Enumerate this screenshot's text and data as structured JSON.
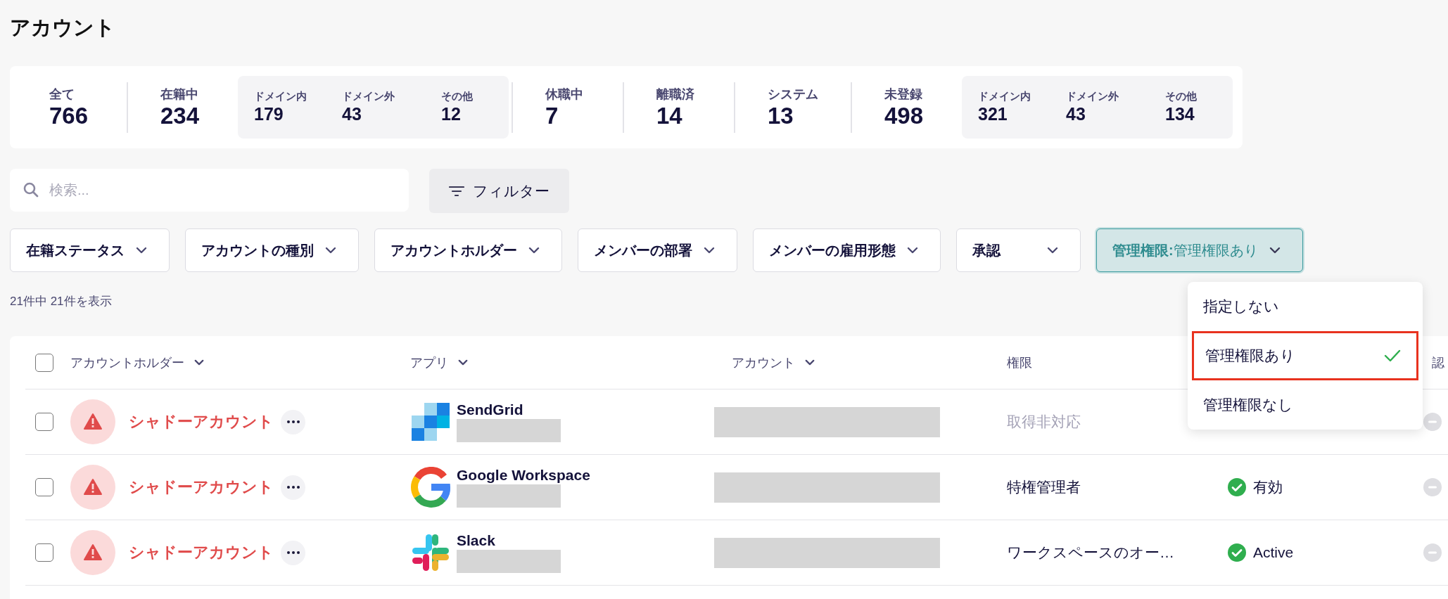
{
  "page": {
    "title": "アカウント"
  },
  "stats": [
    {
      "kind": "stat",
      "label": "全て",
      "value": "766"
    },
    {
      "kind": "stat",
      "label": "在籍中",
      "value": "234"
    },
    {
      "kind": "group",
      "items": [
        {
          "label": "ドメイン内",
          "value": "179"
        },
        {
          "label": "ドメイン外",
          "value": "43"
        },
        {
          "label": "その他",
          "value": "12"
        }
      ]
    },
    {
      "kind": "stat",
      "label": "休職中",
      "value": "7"
    },
    {
      "kind": "stat",
      "label": "離職済",
      "value": "14"
    },
    {
      "kind": "stat",
      "label": "システム",
      "value": "13"
    },
    {
      "kind": "stat",
      "label": "未登録",
      "value": "498"
    },
    {
      "kind": "group",
      "items": [
        {
          "label": "ドメイン内",
          "value": "321"
        },
        {
          "label": "ドメイン外",
          "value": "43"
        },
        {
          "label": "その他",
          "value": "134"
        }
      ]
    }
  ],
  "search": {
    "placeholder": "検索..."
  },
  "filter_button": {
    "label": "フィルター"
  },
  "filters": [
    {
      "label": "在籍ステータス",
      "active": false
    },
    {
      "label": "アカウントの種別",
      "active": false
    },
    {
      "label": "アカウントホルダー",
      "active": false
    },
    {
      "label": "メンバーの部署",
      "active": false
    },
    {
      "label": "メンバーの雇用形態",
      "active": false
    },
    {
      "label": "承認",
      "active": false
    },
    {
      "label": "管理権限:",
      "value": "管理権限あり",
      "active": true
    }
  ],
  "dropdown": {
    "options": [
      {
        "label": "指定しない",
        "selected": false
      },
      {
        "label": "管理権限あり",
        "selected": true
      },
      {
        "label": "管理権限なし",
        "selected": false
      }
    ]
  },
  "result_count": "21件中 21件を表示",
  "table": {
    "columns": {
      "holder": {
        "label": "アカウントホルダー",
        "sortable": true
      },
      "app": {
        "label": "アプリ",
        "sortable": true
      },
      "account": {
        "label": "アカウント",
        "sortable": true
      },
      "permission": {
        "label": "権限",
        "sortable": false
      },
      "approval": {
        "label": "認"
      }
    },
    "header_checked": false,
    "rows": [
      {
        "checked": false,
        "holder": "シャドーアカウント",
        "app": {
          "name": "SendGrid",
          "kind": "sendgrid"
        },
        "permission": "取得非対応",
        "permission_available": false
      },
      {
        "checked": false,
        "holder": "シャドーアカウント",
        "app": {
          "name": "Google Workspace",
          "kind": "google"
        },
        "permission": "特権管理者",
        "permission_available": true,
        "status": "有効",
        "status_ok": true
      },
      {
        "checked": false,
        "holder": "シャドーアカウント",
        "app": {
          "name": "Slack",
          "kind": "slack"
        },
        "permission": "ワークスペースのオー…",
        "permission_available": true,
        "status": "Active",
        "status_ok": true
      }
    ]
  }
}
